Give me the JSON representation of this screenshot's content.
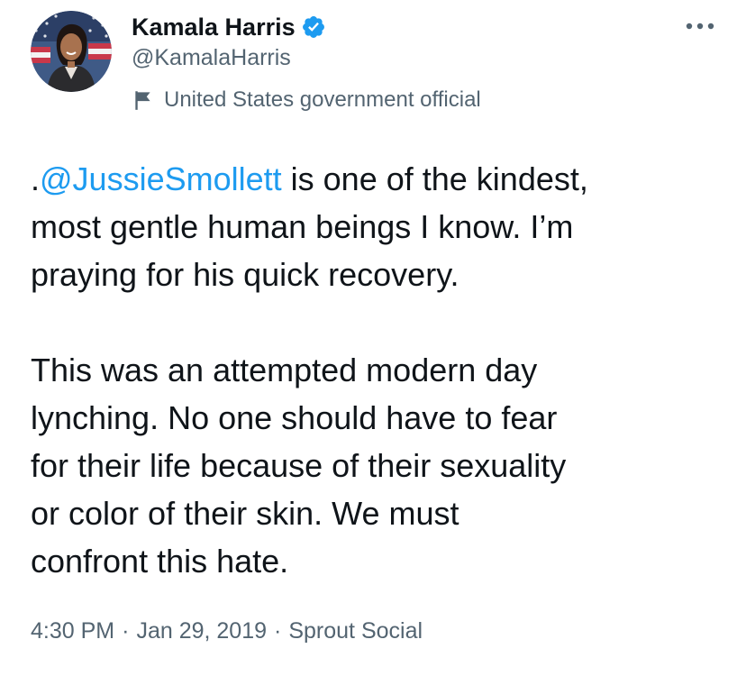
{
  "author": {
    "name": "Kamala Harris",
    "handle": "@KamalaHarris",
    "label": "United States government official",
    "verified_color": "#1d9bf0",
    "avatar_icon": "profile-photo"
  },
  "tweet": {
    "paragraph1": {
      "mention_prefix": ".",
      "mention": "@JussieSmollett",
      "line1_rest": " is one of the kindest,",
      "line2": "most gentle human beings I know. I’m",
      "line3": "praying for his quick recovery."
    },
    "paragraph2": {
      "line1": "This was an attempted modern day",
      "line2": "lynching. No one should have to fear",
      "line3": "for their life because of their sexuality",
      "line4": "or color of their skin. We must",
      "line5": "confront this hate."
    }
  },
  "meta": {
    "time": "4:30 PM",
    "separator": "·",
    "date": "Jan 29, 2019",
    "source": "Sprout Social"
  },
  "colors": {
    "text": "#0f1419",
    "secondary": "#536471",
    "link": "#1d9bf0"
  },
  "icons": {
    "more": "more-horizontal-icon",
    "flag": "flag-icon",
    "verified": "verified-badge-icon"
  }
}
